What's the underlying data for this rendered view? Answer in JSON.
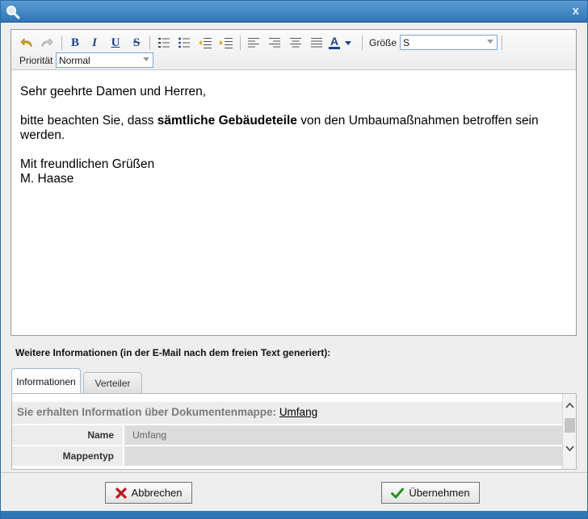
{
  "window": {
    "close_label": "x"
  },
  "toolbar": {
    "bold": "B",
    "italic": "I",
    "underline": "U",
    "strike": "S",
    "font_color_glyph": "A",
    "size_label": "Größe",
    "size_value": "S",
    "priority_label": "Priorität",
    "priority_value": "Normal"
  },
  "content": {
    "greeting": "Sehr geehrte Damen und Herren,",
    "body_before": "bitte beachten Sie, dass ",
    "body_bold": "sämtliche Gebäudeteile",
    "body_after": " von den Umbaumaßnahmen betroffen sein werden.",
    "closing": "Mit freundlichen Grüßen",
    "signature": "M. Haase"
  },
  "info": {
    "title": "Weitere Informationen (in der E-Mail nach dem freien Text generiert):",
    "tabs": [
      {
        "label": "Informationen"
      },
      {
        "label": "Verteiler"
      }
    ],
    "header_text": "Sie erhalten Information über Dokumentenmappe: ",
    "header_link": "Umfang",
    "rows": [
      {
        "key": "Name",
        "value": "Umfang"
      },
      {
        "key": "Mappentyp",
        "value": ""
      }
    ]
  },
  "buttons": {
    "cancel": "Abbrechen",
    "apply": "Übernehmen"
  },
  "colors": {
    "titlebar": "#2f76b8",
    "cancel_icon": "#c0161b",
    "apply_icon": "#2a8f24"
  }
}
